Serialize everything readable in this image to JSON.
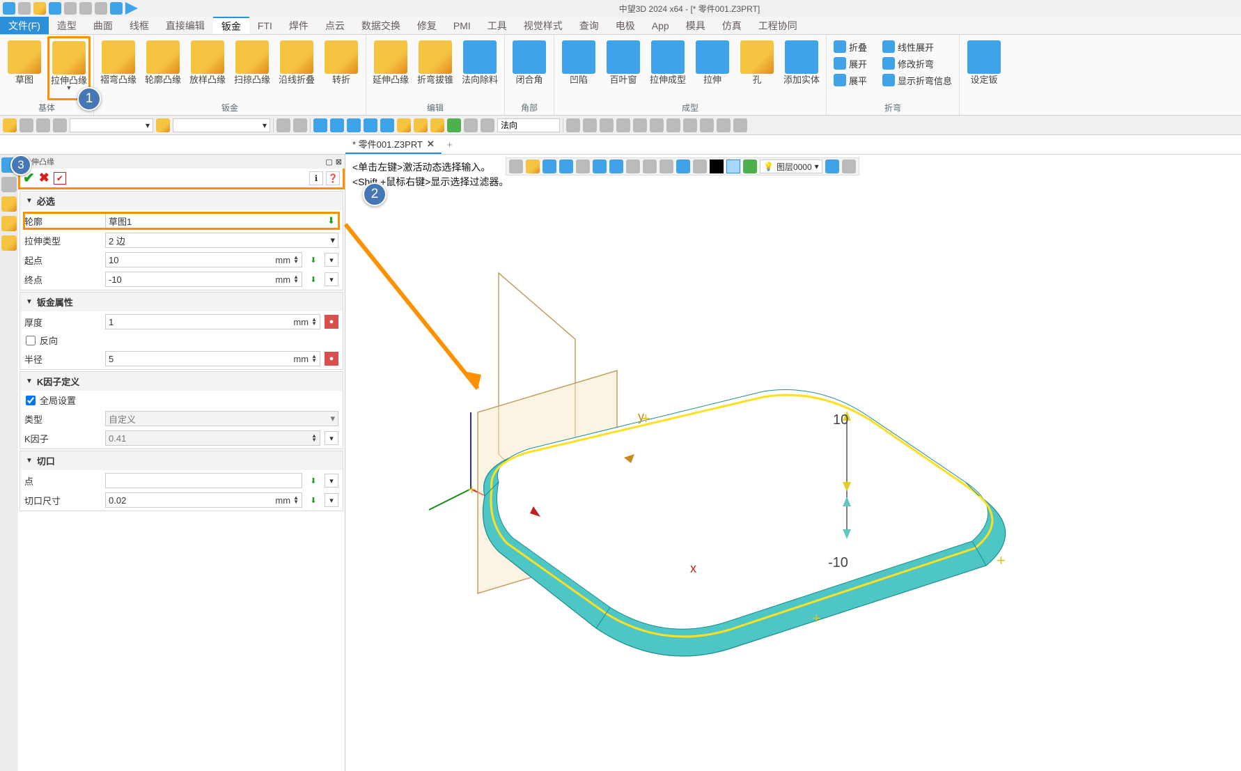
{
  "app_title": "中望3D 2024 x64 - [* 零件001.Z3PRT]",
  "menu": {
    "file": "文件(F)",
    "tabs": [
      "造型",
      "曲面",
      "线框",
      "直接编辑",
      "钣金",
      "FTI",
      "焊件",
      "点云",
      "数据交换",
      "修复",
      "PMI",
      "工具",
      "视觉样式",
      "查询",
      "电极",
      "App",
      "模具",
      "仿真",
      "工程协同"
    ],
    "active": "钣金"
  },
  "ribbon": {
    "groups": [
      {
        "name": "基体",
        "btns": [
          {
            "label": "草图",
            "icon": "sketch-icon"
          },
          {
            "label": "拉伸凸缘",
            "icon": "extrude-flange-icon",
            "dropdown": true,
            "highlight": true,
            "callout": 1
          }
        ]
      },
      {
        "name": "钣金",
        "btns": [
          {
            "label": "褶弯凸缘",
            "icon": "hem-flange-icon"
          },
          {
            "label": "轮廓凸缘",
            "icon": "profile-flange-icon"
          },
          {
            "label": "放样凸缘",
            "icon": "loft-flange-icon"
          },
          {
            "label": "扫掠凸缘",
            "icon": "sweep-flange-icon"
          },
          {
            "label": "沿线折叠",
            "icon": "fold-along-line-icon"
          },
          {
            "label": "转折",
            "icon": "jog-icon"
          }
        ]
      },
      {
        "name": "编辑",
        "btns": [
          {
            "label": "延伸凸缘",
            "icon": "extend-flange-icon"
          },
          {
            "label": "折弯拔锥",
            "icon": "bend-taper-icon"
          },
          {
            "label": "法向除料",
            "icon": "normal-cut-icon"
          }
        ]
      },
      {
        "name": "角部",
        "btns": [
          {
            "label": "闭合角",
            "icon": "close-corner-icon"
          }
        ]
      },
      {
        "name": "成型",
        "btns": [
          {
            "label": "凹陷",
            "icon": "dimple-icon"
          },
          {
            "label": "百叶窗",
            "icon": "louver-icon"
          },
          {
            "label": "拉伸成型",
            "icon": "stretch-form-icon"
          },
          {
            "label": "拉伸",
            "icon": "extrude-icon"
          },
          {
            "label": "孔",
            "icon": "hole-icon"
          },
          {
            "label": "添加实体",
            "icon": "add-body-icon"
          }
        ]
      }
    ],
    "fold_group": {
      "name": "折弯",
      "btns": [
        {
          "label": "折叠",
          "icon": "fold-icon"
        },
        {
          "label": "展开",
          "icon": "unfold-icon"
        },
        {
          "label": "展平",
          "icon": "flatten-icon"
        },
        {
          "label": "线性展开",
          "icon": "linear-unfold-icon"
        },
        {
          "label": "修改折弯",
          "icon": "edit-bend-icon"
        },
        {
          "label": "显示折弯信息",
          "icon": "bend-info-icon"
        }
      ]
    },
    "right_btn": {
      "label": "设定钣",
      "icon": "sheet-setting-icon"
    }
  },
  "subbar": {
    "direction_input": "法向",
    "layer_input": "图层0000"
  },
  "doctab": {
    "title": "* 零件001.Z3PRT"
  },
  "panel": {
    "head": "拉伸凸缘",
    "sections": {
      "required": {
        "title": "必选",
        "fields": [
          {
            "label": "轮廓",
            "value": "草图1",
            "hl": true
          },
          {
            "label": "拉伸类型",
            "value": "2 边",
            "type": "select"
          },
          {
            "label": "起点",
            "value": "10",
            "unit": "mm"
          },
          {
            "label": "终点",
            "value": "-10",
            "unit": "mm"
          }
        ]
      },
      "sheet": {
        "title": "钣金属性",
        "fields": [
          {
            "label": "厚度",
            "value": "1",
            "unit": "mm"
          },
          {
            "label": "反向",
            "type": "check",
            "checked": false
          },
          {
            "label": "半径",
            "value": "5",
            "unit": "mm"
          }
        ]
      },
      "kfactor": {
        "title": "K因子定义",
        "fields": [
          {
            "label": "全局设置",
            "type": "check",
            "checked": true
          },
          {
            "label": "类型",
            "value": "自定义",
            "type": "select",
            "readonly": true
          },
          {
            "label": "K因子",
            "value": "0.41",
            "readonly": true
          }
        ]
      },
      "cut": {
        "title": "切口",
        "fields": [
          {
            "label": "点",
            "value": ""
          },
          {
            "label": "切口尺寸",
            "value": "0.02",
            "unit": "mm"
          }
        ]
      }
    }
  },
  "canvas": {
    "hint1": "<单击左键>激活动态选择输入。",
    "hint2": "<Shift +鼠标右键>显示选择过滤器。",
    "dim_top": "10",
    "dim_bot": "-10"
  }
}
